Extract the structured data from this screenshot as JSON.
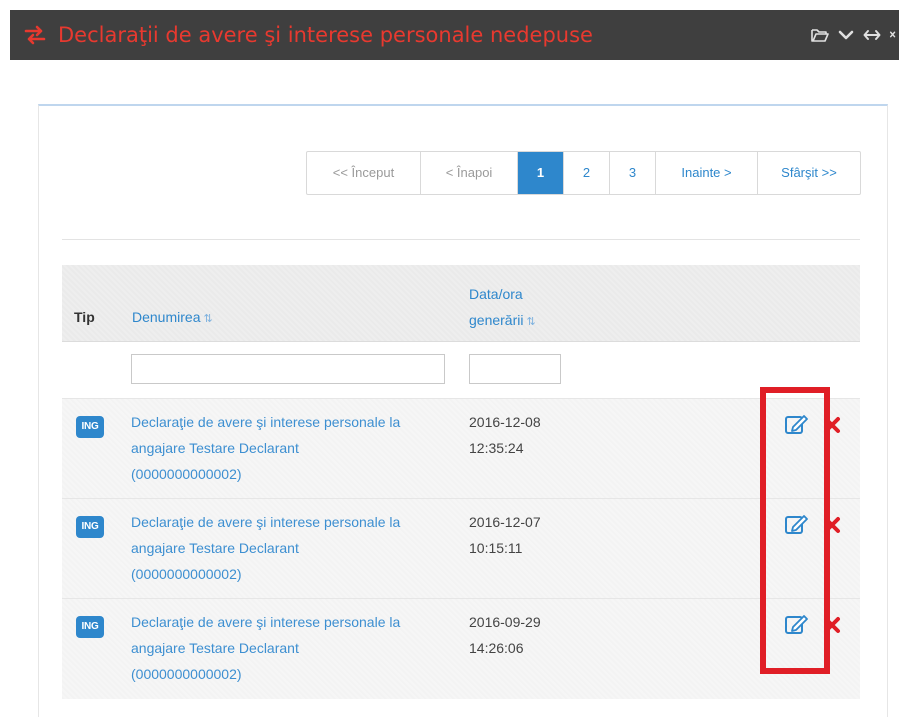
{
  "header": {
    "title": "Declaraţii de avere şi interese personale nedepuse",
    "icon": "exchange-arrows-icon",
    "tools": [
      "folder-open-icon",
      "chevron-down-icon",
      "horizontal-resize-icon",
      "close-icon"
    ]
  },
  "pagination": {
    "first": "<< Început",
    "prev": "< Înapoi",
    "pages": [
      "1",
      "2",
      "3"
    ],
    "active_page": "1",
    "next": "Inainte >",
    "last": "Sfârşit >>"
  },
  "table": {
    "headers": {
      "tip": "Tip",
      "name": "Denumirea",
      "date_line1": "Data/ora",
      "date_line2": "generării",
      "sort_glyph": "⇅"
    },
    "filters": {
      "name_value": "",
      "date_value": ""
    },
    "rows": [
      {
        "badge": "ING",
        "name_line1": "Declaraţie de avere şi interese personale la",
        "name_line2": "angajare Testare Declarant",
        "name_line3": "(0000000000002)",
        "date": "2016-12-08",
        "time": "12:35:24"
      },
      {
        "badge": "ING",
        "name_line1": "Declaraţie de avere şi interese personale la",
        "name_line2": "angajare Testare Declarant",
        "name_line3": "(0000000000002)",
        "date": "2016-12-07",
        "time": "10:15:11"
      },
      {
        "badge": "ING",
        "name_line1": "Declaraţie de avere şi interese personale la",
        "name_line2": "angajare Testare Declarant",
        "name_line3": "(0000000000002)",
        "date": "2016-09-29",
        "time": "14:26:06"
      }
    ]
  },
  "colors": {
    "header_bg": "#3f3f3f",
    "header_title": "#e8392f",
    "accent_blue": "#2e87cc",
    "delete_red": "#e01e26",
    "highlight_red": "#e01e26"
  }
}
